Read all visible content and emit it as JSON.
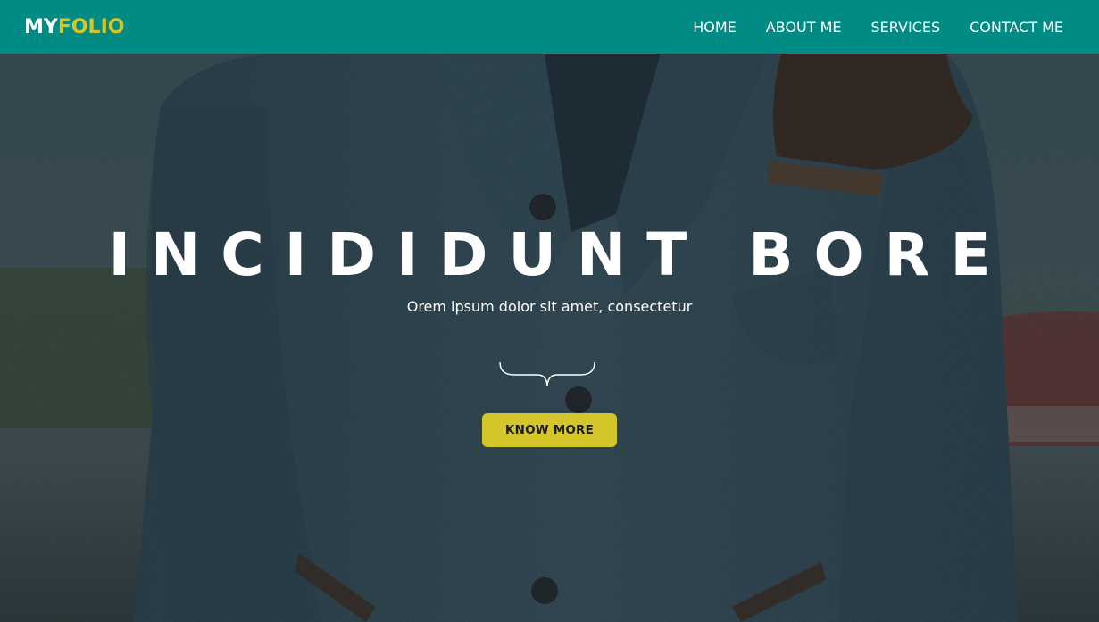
{
  "brand": {
    "part1": "MY",
    "part2": "FOLIO"
  },
  "nav": {
    "items": [
      {
        "label": "HOME"
      },
      {
        "label": "ABOUT ME"
      },
      {
        "label": "SERVICES"
      },
      {
        "label": "CONTACT ME"
      }
    ]
  },
  "hero": {
    "title": "INCIDIDUNT BORE",
    "subtitle": "Orem ipsum dolor sit amet, consectetur",
    "cta_label": "KNOW MORE"
  },
  "colors": {
    "navbar": "#008b84",
    "accent": "#d4c52a",
    "text": "#ffffff"
  },
  "icons": {
    "divider": "curly-brace-divider-icon"
  }
}
